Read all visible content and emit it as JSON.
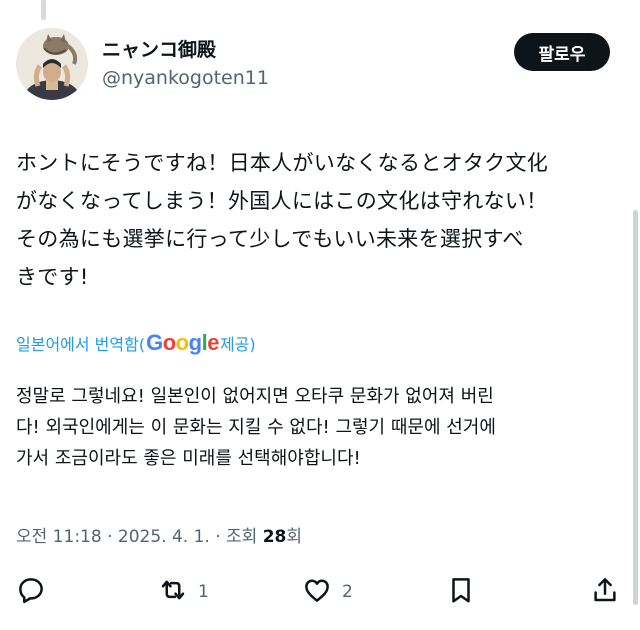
{
  "author": {
    "display_name": "ニャンコ御殿",
    "handle": "@nyankogoten11"
  },
  "follow_button": {
    "label": "팔로우"
  },
  "tweet": {
    "lines": [
      "ホントにそうですね！日本人がいなくなるとオタク文化",
      "がなくなってしまう！外国人にはこの文化は守れない！",
      "その為にも選挙に行って少しでもいい未来を選択すべ",
      "きです!"
    ]
  },
  "translation_notice": {
    "prefix": "일본어에서 번역함(",
    "google_letters": [
      "G",
      "o",
      "o",
      "g",
      "l",
      "e"
    ],
    "suffix": " 제공)",
    "colors": [
      "#4285f4",
      "#ea4335",
      "#fbbc05",
      "#4285f4",
      "#34a853",
      "#ea4335"
    ]
  },
  "translation": {
    "lines": [
      "정말로 그렇네요! 일본인이 없어지면 오타쿠 문화가 없어져 버린",
      "다! 외국인에게는 이 문화는 지킬 수 없다! 그렇기 때문에 선거에",
      "가서 조금이라도 좋은 미래를 선택해야합니다!"
    ]
  },
  "meta": {
    "time_date": "오전 11:18 · 2025. 4. 1. · 조회 ",
    "views": "28",
    "views_suffix": "회"
  },
  "actions": {
    "reply": {
      "icon": "reply-icon"
    },
    "retweet": {
      "icon": "retweet-icon",
      "count": "1"
    },
    "like": {
      "icon": "heart-icon",
      "count": "2"
    },
    "bookmark": {
      "icon": "bookmark-icon"
    },
    "share": {
      "icon": "share-icon"
    }
  },
  "colors": {
    "text": "#0f1419",
    "secondary": "#536471",
    "link": "#1d9bf0",
    "button_bg": "#0f1419"
  }
}
